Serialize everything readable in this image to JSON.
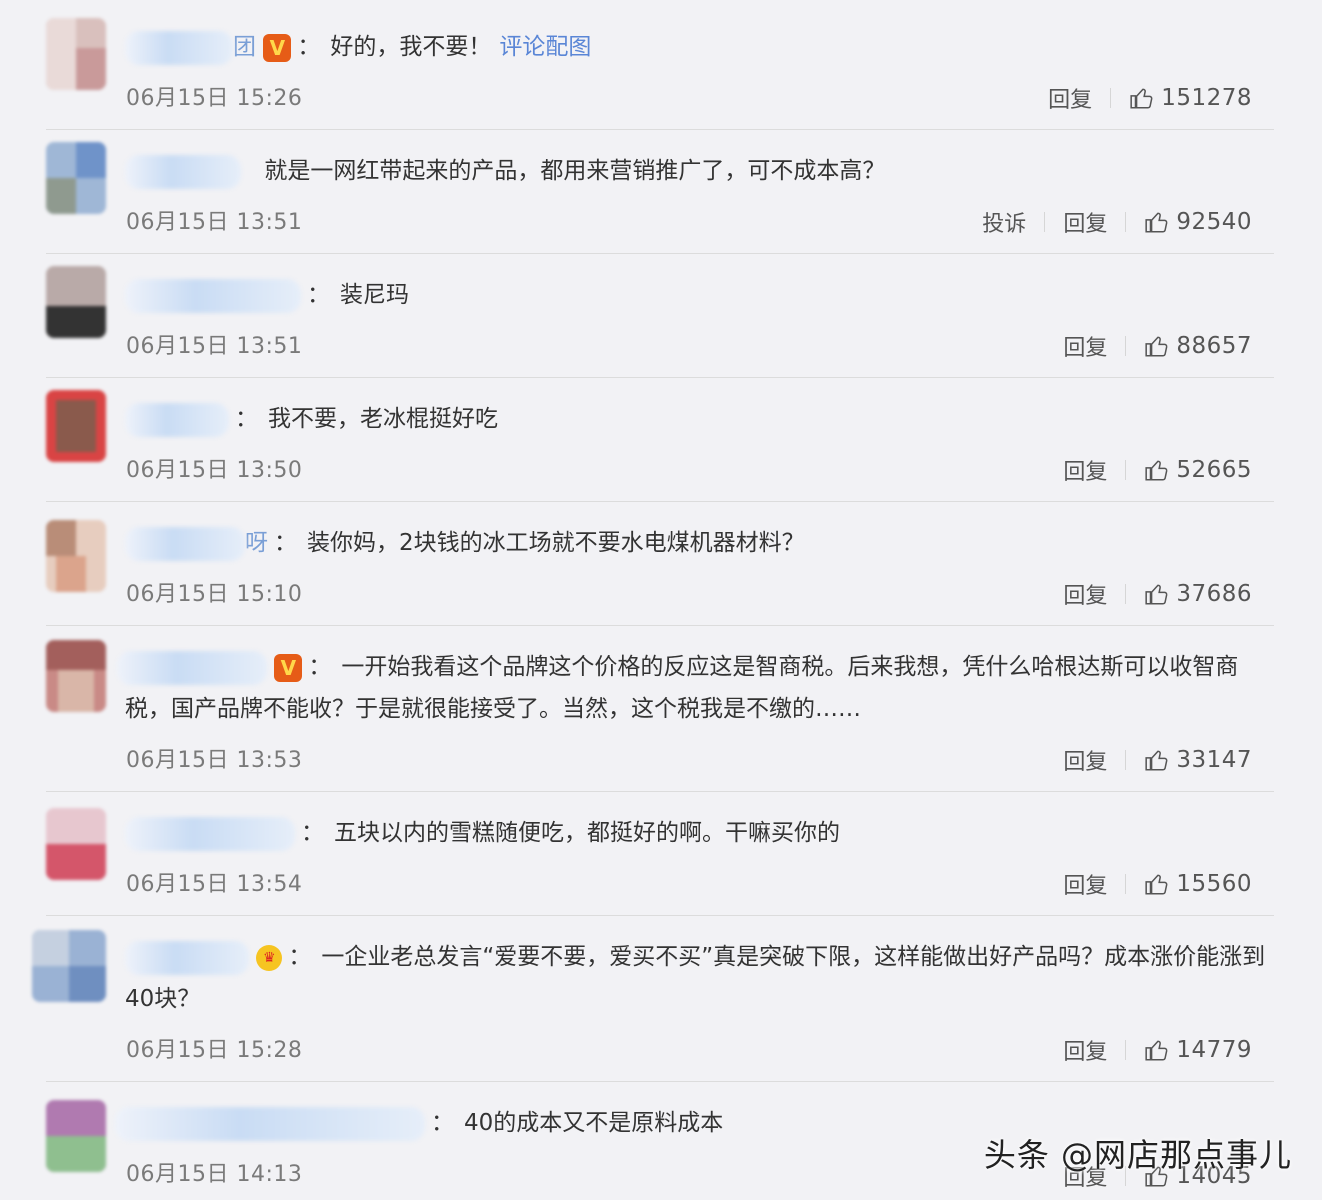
{
  "comments": [
    {
      "text": "好的，我不要！",
      "link": "评论配图",
      "nick_frag": "团",
      "time": "06月15日 15:26",
      "actions": [
        "回复"
      ],
      "likes": "151278"
    },
    {
      "text": "就是一网红带起来的产品，都用来营销推广了，可不成本高？",
      "time": "06月15日 13:51",
      "actions": [
        "投诉",
        "回复"
      ],
      "likes": "92540"
    },
    {
      "text": "装尼玛",
      "time": "06月15日 13:51",
      "actions": [
        "回复"
      ],
      "likes": "88657"
    },
    {
      "text": "我不要，老冰棍挺好吃",
      "time": "06月15日 13:50",
      "actions": [
        "回复"
      ],
      "likes": "52665"
    },
    {
      "text": "装你妈，2块钱的冰工场就不要水电煤机器材料？",
      "nick_frag": "呀",
      "time": "06月15日 15:10",
      "actions": [
        "回复"
      ],
      "likes": "37686"
    },
    {
      "text": "一开始我看这个品牌这个价格的反应这是智商税。后来我想，凭什么哈根达斯可以收智商税，国产品牌不能收？于是就很能接受了。当然，这个税我是不缴的……",
      "time": "06月15日 13:53",
      "actions": [
        "回复"
      ],
      "likes": "33147"
    },
    {
      "text": "五块以内的雪糕随便吃，都挺好的啊。干嘛买你的",
      "time": "06月15日 13:54",
      "actions": [
        "回复"
      ],
      "likes": "15560"
    },
    {
      "text": "一企业老总发言“爱要不要，爱买不买”真是突破下限，这样能做出好产品吗？成本涨价能涨到40块？",
      "time": "06月15日 15:28",
      "actions": [
        "回复"
      ],
      "likes": "14779"
    },
    {
      "text": "40的成本又不是原料成本",
      "time": "06月15日 14:13",
      "actions": [
        "回复"
      ],
      "likes": "14045"
    }
  ],
  "badges": {
    "v": "V",
    "crown": "♛"
  },
  "colon": "：",
  "watermark": "头条 @网店那点事儿",
  "colors": {
    "link": "#5a86d6",
    "badge_v": "#e65c17",
    "crown": "#f6c421",
    "divider": "#dcdcdc"
  }
}
